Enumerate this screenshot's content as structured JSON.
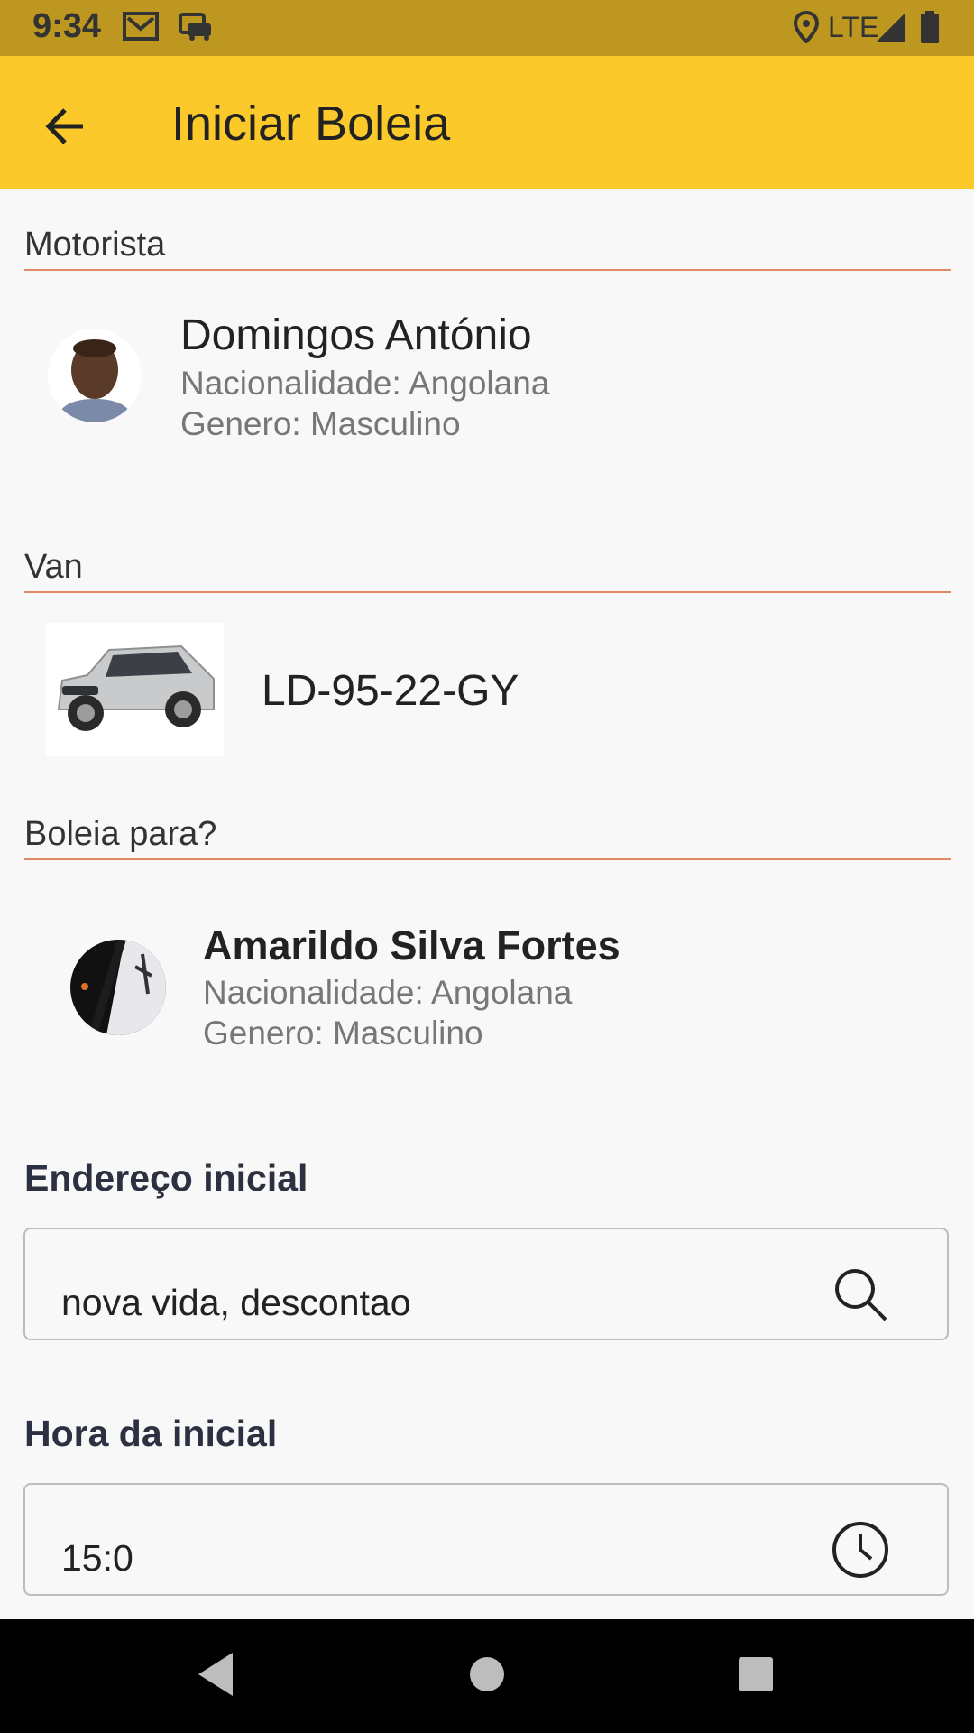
{
  "status_bar": {
    "time": "9:34",
    "network": "LTE",
    "icons": [
      "gmail-icon",
      "car-notification-icon",
      "location-icon",
      "signal-icon",
      "battery-icon"
    ]
  },
  "app_bar": {
    "title": "Iniciar Boleia",
    "back_icon": "arrow-back-icon"
  },
  "driver_section": {
    "label": "Motorista",
    "name": "Domingos António",
    "nationality": "Nacionalidade: Angolana",
    "gender": "Genero: Masculino"
  },
  "van_section": {
    "label": "Van",
    "plate": "LD-95-22-GY"
  },
  "rider_section": {
    "label": "Boleia para?",
    "name": "Amarildo Silva Fortes",
    "nationality": "Nacionalidade: Angolana",
    "gender": "Genero: Masculino"
  },
  "start_address": {
    "heading": "Endereço inicial",
    "value": "nova vida, descontao",
    "icon": "search-icon"
  },
  "start_time": {
    "heading": "Hora da inicial",
    "value": "15:0",
    "icon": "clock-icon"
  },
  "colors": {
    "status_bar": "#bd971f",
    "app_bar": "#fcc92b",
    "divider": "#e08a6a",
    "background": "#f8f8f8"
  }
}
